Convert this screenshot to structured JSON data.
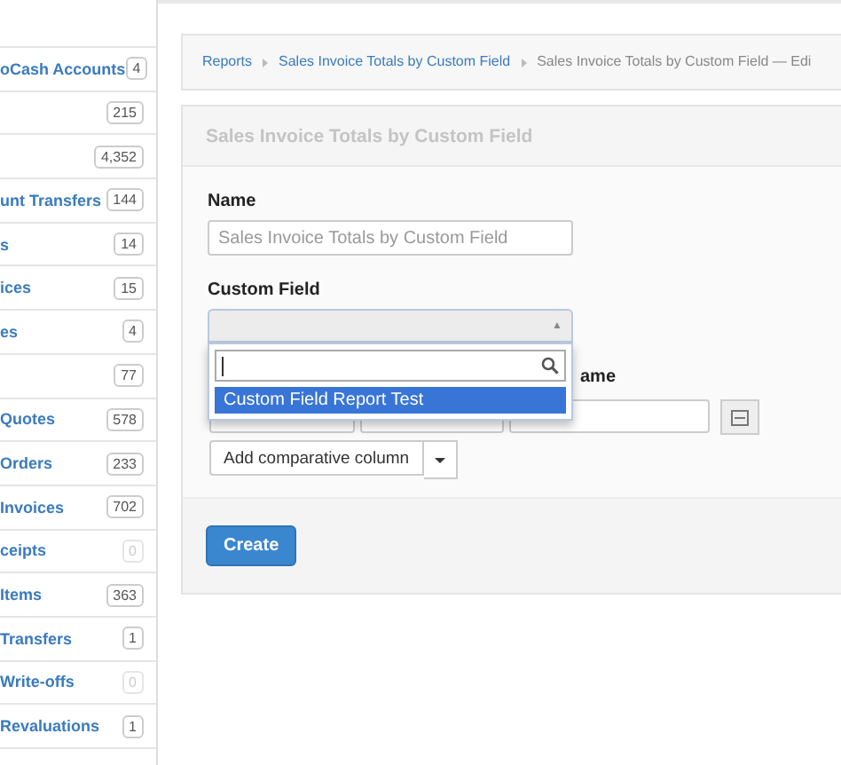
{
  "sidebar": {
    "items": [
      {
        "label": "oCash Accounts",
        "count": "4",
        "muted": false
      },
      {
        "count": "215",
        "muted": false
      },
      {
        "count": "4,352",
        "muted": false
      },
      {
        "label": "unt Transfers",
        "count": "144",
        "muted": false
      },
      {
        "label": "s",
        "count": "14",
        "muted": false
      },
      {
        "label": "ices",
        "count": "15",
        "muted": false
      },
      {
        "label": "es",
        "count": "4",
        "muted": false
      },
      {
        "count": "77",
        "muted": false
      },
      {
        "label": "Quotes",
        "count": "578",
        "muted": false
      },
      {
        "label": "Orders",
        "count": "233",
        "muted": false
      },
      {
        "label": "Invoices",
        "count": "702",
        "muted": false
      },
      {
        "label": "ceipts",
        "count": "0",
        "muted": true
      },
      {
        "label": "Items",
        "count": "363",
        "muted": false
      },
      {
        "label": "Transfers",
        "count": "1",
        "muted": false
      },
      {
        "label": "Write-offs",
        "count": "0",
        "muted": true
      },
      {
        "label": "Revaluations",
        "count": "1",
        "muted": false
      }
    ]
  },
  "breadcrumb": [
    {
      "label": "Reports",
      "link": true
    },
    {
      "label": "Sales Invoice Totals by Custom Field",
      "link": true
    },
    {
      "label": "Sales Invoice Totals by Custom Field — Edi",
      "link": false
    }
  ],
  "panel": {
    "title": "Sales Invoice Totals by Custom Field",
    "name_label": "Name",
    "name_placeholder": "Sales Invoice Totals by Custom Field",
    "custom_field_label": "Custom Field",
    "dropdown": {
      "expanded": true,
      "caret": "▲",
      "options": [
        {
          "label": "Custom Field Report Test",
          "selected": true
        }
      ]
    },
    "column_name_label": "ame",
    "add_column_button": "Add comparative column",
    "create_button": "Create"
  }
}
